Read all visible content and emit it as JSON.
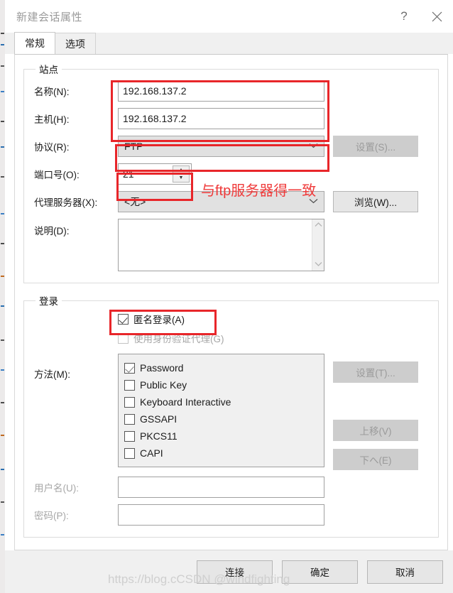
{
  "window": {
    "title": "新建会话属性",
    "help_label": "?",
    "close_label": "✕"
  },
  "tabs": [
    {
      "label": "常规",
      "active": true
    },
    {
      "label": "选项",
      "active": false
    }
  ],
  "site_group": {
    "legend": "站点",
    "name_label": "名称(N):",
    "name_value": "192.168.137.2",
    "host_label": "主机(H):",
    "host_value": "192.168.137.2",
    "protocol_label": "协议(R):",
    "protocol_value": "FTP",
    "protocol_settings_button": "设置(S)...",
    "port_label": "端口号(O):",
    "port_value": "21",
    "proxy_label": "代理服务器(X):",
    "proxy_value": "<无>",
    "proxy_browse_button": "浏览(W)...",
    "description_label": "说明(D):",
    "description_value": ""
  },
  "login_group": {
    "legend": "登录",
    "anonymous_label": "匿名登录(A)",
    "anonymous_checked": true,
    "auth_agent_label": "使用身份验证代理(G)",
    "auth_agent_checked": false,
    "methods_label": "方法(M):",
    "methods": [
      {
        "label": "Password",
        "checked": true
      },
      {
        "label": "Public Key",
        "checked": false
      },
      {
        "label": "Keyboard Interactive",
        "checked": false
      },
      {
        "label": "GSSAPI",
        "checked": false
      },
      {
        "label": "PKCS11",
        "checked": false
      },
      {
        "label": "CAPI",
        "checked": false
      }
    ],
    "method_settings_button": "设置(T)...",
    "move_up_button": "上移(V)",
    "move_down_button": "下へ(E)",
    "username_label": "用户名(U):",
    "username_value": "",
    "password_label": "密码(P):",
    "password_value": ""
  },
  "footer": {
    "connect_button": "连接",
    "ok_button": "确定",
    "cancel_button": "取消"
  },
  "annotations": {
    "port_note": "与ftp服务器得一致"
  },
  "watermark": {
    "text": "https://blog.cCSDN @windfighting"
  },
  "colors": {
    "annotation_red": "#e8262a",
    "annotation_text_red": "#ef3a3a",
    "dialog_bg": "#ffffff",
    "chrome_gray": "#f0f0f0",
    "disabled_gray": "#cdcdcd"
  }
}
